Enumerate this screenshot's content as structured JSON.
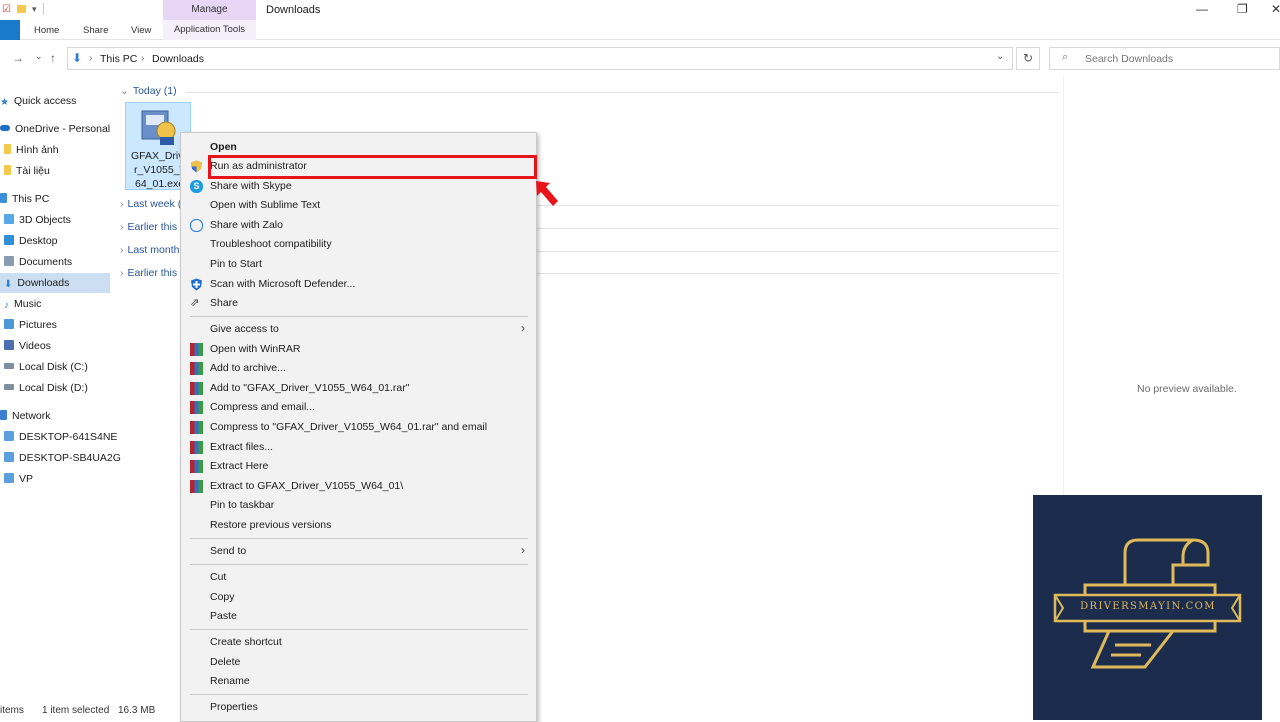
{
  "window": {
    "title": "Downloads",
    "manage_tab": "Manage",
    "tabs": [
      "Home",
      "Share",
      "View"
    ],
    "contextual_tab": "Application Tools"
  },
  "address": {
    "crumbs": [
      "This PC",
      "Downloads"
    ],
    "search_placeholder": "Search Downloads"
  },
  "nav": [
    {
      "label": "Quick access",
      "icon": "star-icon",
      "color": "#2f7fd0"
    },
    {
      "label": "OneDrive - Personal",
      "icon": "cloud-icon",
      "color": "#1c6fc8"
    },
    {
      "label": "Hình ảnh",
      "icon": "folder-icon",
      "color": "#f3c84b"
    },
    {
      "label": "Tài liệu",
      "icon": "folder-icon",
      "color": "#f3c84b"
    },
    {
      "label": "This PC",
      "icon": "computer-icon",
      "color": "#3b8fd8"
    },
    {
      "label": "3D Objects",
      "icon": "cube-icon",
      "color": "#56a9e6"
    },
    {
      "label": "Desktop",
      "icon": "desktop-icon",
      "color": "#2f8fd8"
    },
    {
      "label": "Documents",
      "icon": "documents-icon",
      "color": "#8a9bb0"
    },
    {
      "label": "Downloads",
      "icon": "download-icon",
      "color": "#2f7fd0"
    },
    {
      "label": "Music",
      "icon": "music-icon",
      "color": "#3b7fd0"
    },
    {
      "label": "Pictures",
      "icon": "pictures-icon",
      "color": "#4b98d8"
    },
    {
      "label": "Videos",
      "icon": "videos-icon",
      "color": "#4b6fb0"
    },
    {
      "label": "Local Disk (C:)",
      "icon": "drive-icon",
      "color": "#7f8fa0"
    },
    {
      "label": "Local Disk (D:)",
      "icon": "drive-icon",
      "color": "#7f8fa0"
    },
    {
      "label": "Network",
      "icon": "network-icon",
      "color": "#3b7fd0"
    },
    {
      "label": "DESKTOP-641S4NE",
      "icon": "pc-icon",
      "color": "#5b9fdf"
    },
    {
      "label": "DESKTOP-SB4UA2G",
      "icon": "pc-icon",
      "color": "#5b9fdf"
    },
    {
      "label": "VP",
      "icon": "pc-icon",
      "color": "#5b9fdf"
    }
  ],
  "content": {
    "groups": [
      "Today (1)",
      "Last week (",
      "Earlier this",
      "Last month",
      "Earlier this"
    ],
    "file_name_lines": [
      "GFAX_Drive",
      "r_V1055_W",
      "64_01.exe"
    ],
    "preview": "No preview available."
  },
  "status": {
    "items": "items",
    "selected": "1 item selected",
    "size": "16.3 MB"
  },
  "menu": {
    "items": [
      "Open",
      "Run as administrator",
      "Share with Skype",
      "Open with Sublime Text",
      "Share with Zalo",
      "Troubleshoot compatibility",
      "Pin to Start",
      "Scan with Microsoft Defender...",
      "Share",
      "Give access to",
      "Open with WinRAR",
      "Add to archive...",
      "Add to \"GFAX_Driver_V1055_W64_01.rar\"",
      "Compress and email...",
      "Compress to \"GFAX_Driver_V1055_W64_01.rar\" and email",
      "Extract files...",
      "Extract Here",
      "Extract to GFAX_Driver_V1055_W64_01\\",
      "Pin to taskbar",
      "Restore previous versions",
      "Send to",
      "Cut",
      "Copy",
      "Paste",
      "Create shortcut",
      "Delete",
      "Rename",
      "Properties"
    ],
    "highlight_color": "#e8141c"
  },
  "logo": {
    "text": "DRIVERSMAYIN.COM",
    "bg": "#1c2c4c",
    "gold": "#e0ba5a"
  }
}
